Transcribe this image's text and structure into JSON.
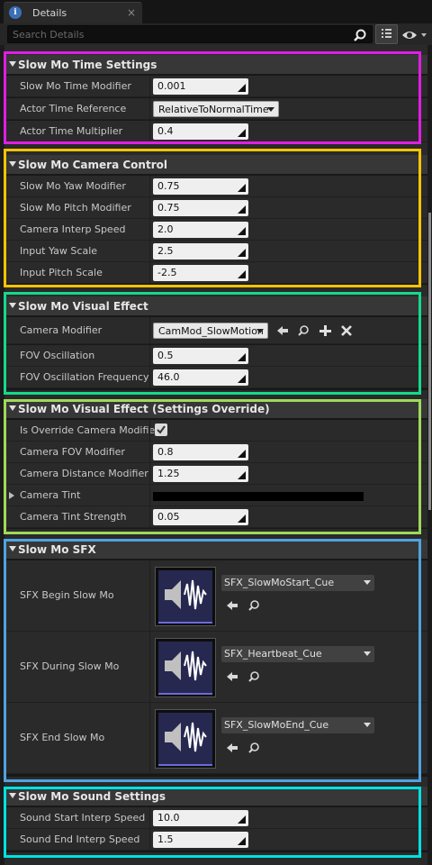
{
  "window": {
    "tab_title": "Details",
    "tab_close": "×",
    "info_glyph": "i"
  },
  "search": {
    "placeholder": "Search Details"
  },
  "colors": {
    "accent_magenta": "#e11ee1",
    "accent_yellow": "#f5c400",
    "accent_green": "#14d98c",
    "accent_lime": "#9fd95a",
    "accent_blue": "#4fa3e3",
    "accent_cyan": "#00e1e1",
    "sound_thumb": "#262850"
  },
  "icons": {
    "search": "search-icon",
    "view_options": "grid-icon",
    "eye": "eye-icon",
    "numeric_drag": "drag-triangle-icon",
    "use_selected": "arrow-left-icon",
    "browse": "magnifier-icon",
    "add": "plus-icon",
    "clear": "x-icon",
    "checkbox": "checkmark-icon",
    "sound": "speaker-icon"
  },
  "categories": {
    "time": {
      "title": "Slow Mo Time Settings",
      "rows": [
        {
          "label": "Slow Mo Time Modifier",
          "value": "0.001"
        },
        {
          "label": "Actor Time Reference",
          "value": "RelativeToNormalTime"
        },
        {
          "label": "Actor Time Multiplier",
          "value": "0.4"
        }
      ]
    },
    "camera": {
      "title": "Slow Mo Camera Control",
      "rows": [
        {
          "label": "Slow Mo Yaw Modifier",
          "value": "0.75"
        },
        {
          "label": "Slow Mo Pitch Modifier",
          "value": "0.75"
        },
        {
          "label": "Camera Interp Speed",
          "value": "2.0"
        },
        {
          "label": "Input Yaw Scale",
          "value": "2.5"
        },
        {
          "label": "Input Pitch Scale",
          "value": "-2.5"
        }
      ]
    },
    "visual": {
      "title": "Slow Mo Visual Effect",
      "rows": [
        {
          "label": "Camera Modifier",
          "value": "CamMod_SlowMotion"
        },
        {
          "label": "FOV Oscillation",
          "value": "0.5"
        },
        {
          "label": "FOV Oscillation Frequency",
          "value": "46.0"
        }
      ]
    },
    "override": {
      "title": "Slow Mo Visual Effect (Settings Override)",
      "rows": [
        {
          "label": "Is Override Camera Modifier",
          "checked": true
        },
        {
          "label": "Camera FOV Modifier",
          "value": "0.8"
        },
        {
          "label": "Camera Distance Modifier",
          "value": "1.25"
        },
        {
          "label": "Camera Tint",
          "color": "#000000"
        },
        {
          "label": "Camera Tint Strength",
          "value": "0.05"
        }
      ]
    },
    "sfx": {
      "title": "Slow Mo SFX",
      "rows": [
        {
          "label": "SFX Begin Slow Mo",
          "value": "SFX_SlowMoStart_Cue"
        },
        {
          "label": "SFX During Slow Mo",
          "value": "SFX_Heartbeat_Cue"
        },
        {
          "label": "SFX End Slow Mo",
          "value": "SFX_SlowMoEnd_Cue"
        }
      ]
    },
    "sound": {
      "title": "Slow Mo Sound Settings",
      "rows": [
        {
          "label": "Sound Start Interp Speed",
          "value": "10.0"
        },
        {
          "label": "Sound End Interp Speed",
          "value": "1.5"
        }
      ]
    }
  }
}
